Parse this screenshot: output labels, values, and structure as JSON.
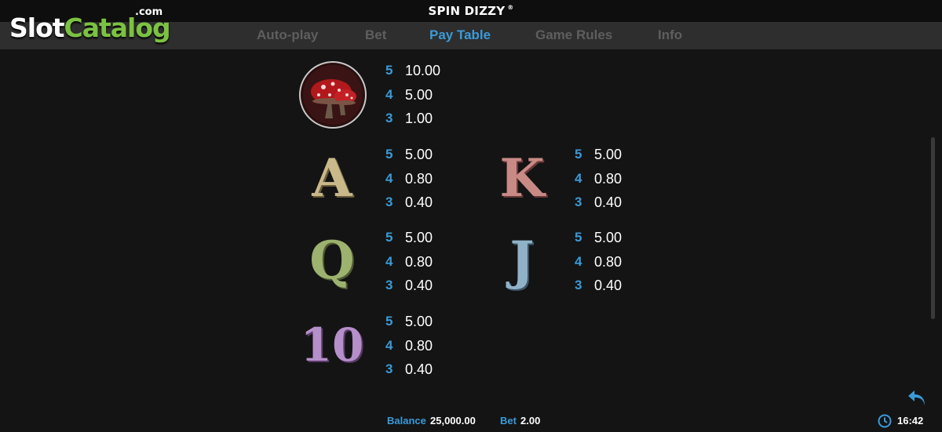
{
  "header": {
    "title": "SPIN DIZZY",
    "title_mark": "®"
  },
  "logo": {
    "slot": "Slot",
    "catalog": "Catalog",
    "com": ".com"
  },
  "tabs": [
    {
      "label": "Auto-play",
      "active": false
    },
    {
      "label": "Bet",
      "active": false
    },
    {
      "label": "Pay Table",
      "active": true
    },
    {
      "label": "Game Rules",
      "active": false
    },
    {
      "label": "Info",
      "active": false
    }
  ],
  "paytable": [
    {
      "symbol": "mushroom",
      "icon": "mushroom-icon",
      "pays": [
        {
          "count": "5",
          "value": "10.00"
        },
        {
          "count": "4",
          "value": "5.00"
        },
        {
          "count": "3",
          "value": "1.00"
        }
      ]
    },
    {
      "symbol": "A",
      "color": "#c9b98a",
      "pays": [
        {
          "count": "5",
          "value": "5.00"
        },
        {
          "count": "4",
          "value": "0.80"
        },
        {
          "count": "3",
          "value": "0.40"
        }
      ]
    },
    {
      "symbol": "K",
      "color": "#c98a86",
      "pays": [
        {
          "count": "5",
          "value": "5.00"
        },
        {
          "count": "4",
          "value": "0.80"
        },
        {
          "count": "3",
          "value": "0.40"
        }
      ]
    },
    {
      "symbol": "Q",
      "color": "#9cb26e",
      "pays": [
        {
          "count": "5",
          "value": "5.00"
        },
        {
          "count": "4",
          "value": "0.80"
        },
        {
          "count": "3",
          "value": "0.40"
        }
      ]
    },
    {
      "symbol": "J",
      "color": "#8fb2c9",
      "pays": [
        {
          "count": "5",
          "value": "5.00"
        },
        {
          "count": "4",
          "value": "0.80"
        },
        {
          "count": "3",
          "value": "0.40"
        }
      ]
    },
    {
      "symbol": "10",
      "color": "#b58fc9",
      "pays": [
        {
          "count": "5",
          "value": "5.00"
        },
        {
          "count": "4",
          "value": "0.80"
        },
        {
          "count": "3",
          "value": "0.40"
        }
      ]
    }
  ],
  "footer": {
    "balance_label": "Balance",
    "balance_value": "25,000.00",
    "bet_label": "Bet",
    "bet_value": "2.00",
    "time": "16:42"
  },
  "colors": {
    "accent": "#3a9ad9",
    "brand_green": "#7cc242",
    "background": "#141414"
  }
}
